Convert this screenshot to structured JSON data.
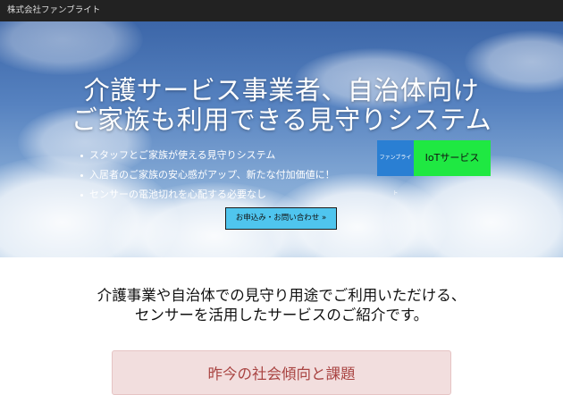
{
  "topbar": {
    "brand": "株式会社ファンブライト"
  },
  "hero": {
    "title_line1": "介護サービス事業者、自治体向け",
    "title_line2": "ご家族も利用できる見守りシステム",
    "features": [
      "スタッフとご家族が使える見守りシステム",
      "入居者のご家族の安心感がアップ、新たな付加価値に！",
      "センサーの電池切れを心配する必要なし"
    ],
    "cta_label": "お申込み・お問い合わせ »",
    "badge_left": "ファンブライト",
    "badge_right": "IoTサービス"
  },
  "intro": {
    "line1": "介護事業や自治体での見守り用途でご利用いただける、",
    "line2": "センサーを活用したサービスのご紹介です。"
  },
  "section": {
    "title": "昨今の社会傾向と課題"
  },
  "colors": {
    "topbar": "#222222",
    "cta": "#4fc5ee",
    "badge_blue": "#2a7fd3",
    "badge_green": "#1fe842",
    "section_bg": "#f2dede",
    "section_text": "#a94442"
  }
}
